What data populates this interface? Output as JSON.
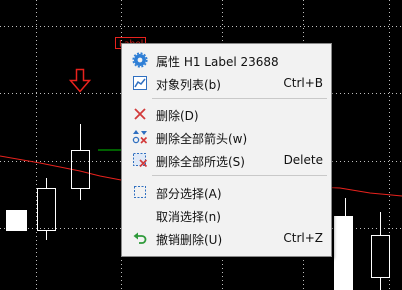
{
  "chart": {
    "object_label_tag": "Label",
    "colors": {
      "background": "#000000",
      "grid": "#ffffff",
      "candle": "#ffffff",
      "indicator_line": "#e8221d",
      "arrow": "#e8221d",
      "cursor_line": "#00c000"
    }
  },
  "menu": {
    "items": [
      {
        "label": "属性 H1 Label 23688",
        "shortcut": "",
        "icon": "gear-icon"
      },
      {
        "label": "对象列表(b)",
        "shortcut": "Ctrl+B",
        "icon": "chart-list-icon"
      },
      {
        "label": "删除(D)",
        "shortcut": "",
        "icon": "x-delete-icon"
      },
      {
        "label": "删除全部箭头(w)",
        "shortcut": "",
        "icon": "arrows-delete-icon"
      },
      {
        "label": "删除全部所选(S)",
        "shortcut": "Delete",
        "icon": "selection-delete-icon"
      },
      {
        "label": "部分选择(A)",
        "shortcut": "",
        "icon": "dashed-select-icon"
      },
      {
        "label": "取消选择(n)",
        "shortcut": "",
        "icon": ""
      },
      {
        "label": "撤销删除(U)",
        "shortcut": "Ctrl+Z",
        "icon": "undo-icon"
      }
    ]
  }
}
